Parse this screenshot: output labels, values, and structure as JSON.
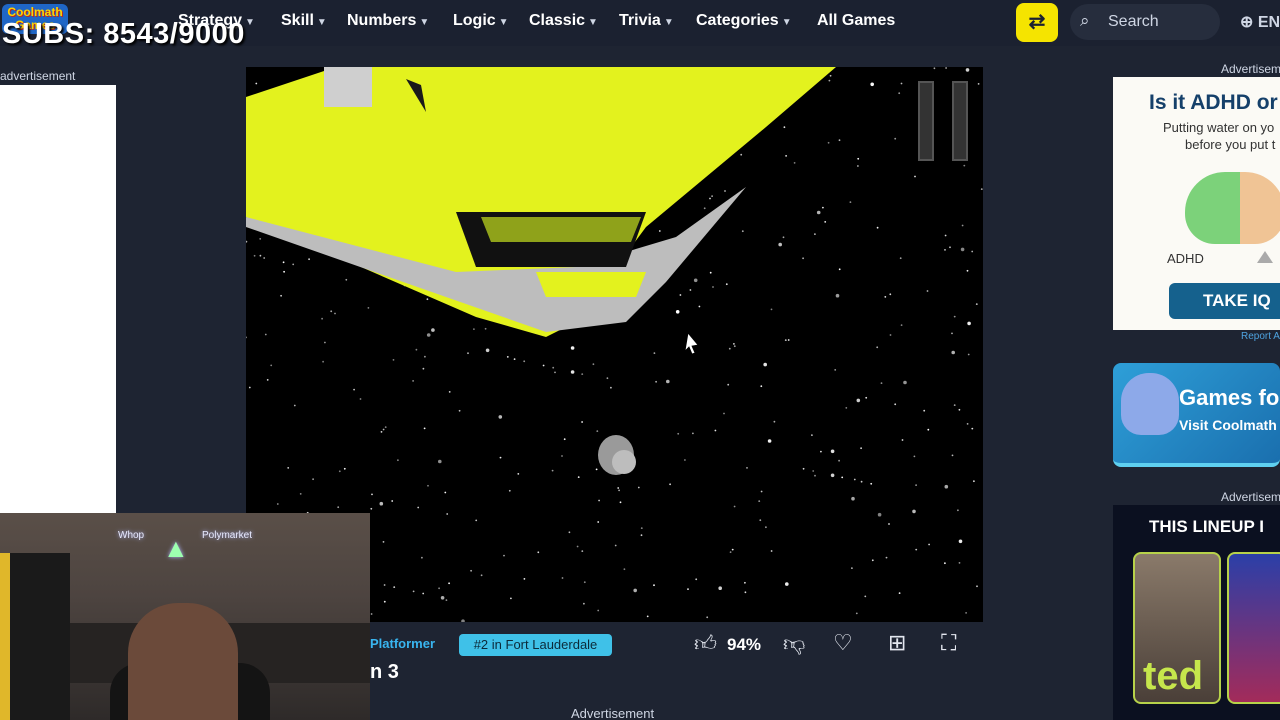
{
  "branding": {
    "logo_text": "Coolmath Games"
  },
  "nav": {
    "items": [
      {
        "label": "Strategy"
      },
      {
        "label": "Skill"
      },
      {
        "label": "Numbers"
      },
      {
        "label": "Logic"
      },
      {
        "label": "Classic"
      },
      {
        "label": "Trivia"
      },
      {
        "label": "Categories"
      },
      {
        "label": "All Games"
      }
    ],
    "search_placeholder": "Search",
    "language": "EN"
  },
  "overlay": {
    "subs_text": "SUBS: 8543/9000"
  },
  "ads": {
    "left_label": "advertisement",
    "right_label_1": "Advertisement",
    "right_label_2": "Advertisement",
    "bottom_label": "Advertisement",
    "iq_ad": {
      "headline": "Is it ADHD or",
      "subtext_1": "Putting water on yo",
      "subtext_2": "before you put t",
      "brain_label": "ADHD",
      "button": "TAKE IQ"
    },
    "report_label": "Report A",
    "games_ad": {
      "title": "Games fo",
      "subtitle": "Visit Coolmath"
    },
    "lineup_ad": {
      "title": "THIS LINEUP I",
      "poster_text": "ted"
    }
  },
  "game_info": {
    "category": "Platformer",
    "rank_badge": "#2 in Fort Lauderdale",
    "title_partial": "n 3",
    "like_percent": "94%"
  },
  "webcam": {
    "sign_1": "Whop",
    "sign_2": "Polymarket"
  },
  "colors": {
    "accent_yellow": "#f5e400",
    "badge_blue": "#3fc1e8",
    "nav_bg": "#1b2130",
    "game_yellow": "#e3f21e"
  }
}
